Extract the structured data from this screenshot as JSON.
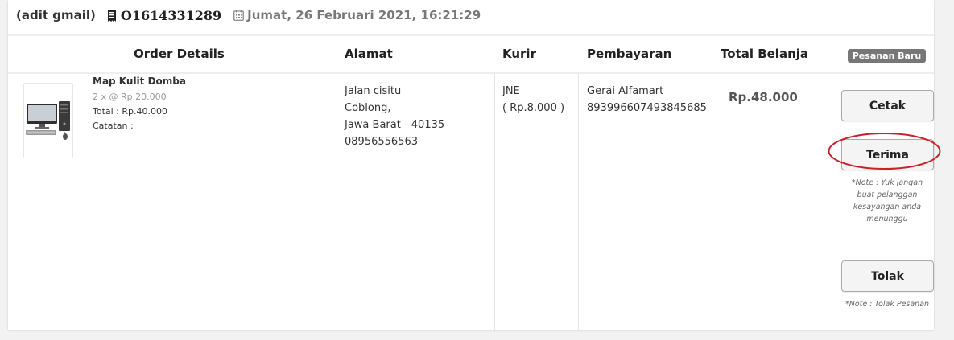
{
  "order": {
    "buyer": "(adit gmail)",
    "number": "O1614331289",
    "date": "Jumat, 26 Februari 2021, 16:21:29",
    "receipt_icon": "receipt-icon",
    "calendar_icon": "calendar-icon"
  },
  "table": {
    "headers": {
      "details": "Order Details",
      "address": "Alamat",
      "courier": "Kurir",
      "payment": "Pembayaran",
      "total": "Total Belanja"
    },
    "status_badge": "Pesanan Baru"
  },
  "item": {
    "name": "Map Kulit Domba",
    "qty_price": "2 x @ Rp.20.000",
    "total": "Total : Rp.40.000",
    "note": "Catatan :",
    "image_icon": "computer-product-image"
  },
  "address": {
    "line1": "Jalan cisitu",
    "line2": "Coblong,",
    "line3": "Jawa Barat - 40135",
    "phone": "08956556563"
  },
  "courier": {
    "name": "JNE",
    "cost": "( Rp.8.000 )"
  },
  "payment": {
    "method": "Gerai Alfamart",
    "code": "893996607493845685"
  },
  "grand_total": "Rp.48.000",
  "actions": {
    "print_label": "Cetak",
    "accept_label": "Terima",
    "accept_note": "*Note : Yuk jangan buat pelanggan kesayangan anda menunggu",
    "reject_label": "Tolak",
    "reject_note": "*Note : Tolak Pesanan"
  },
  "colors": {
    "badge": "#777777",
    "annotation": "#cc1f2a"
  }
}
